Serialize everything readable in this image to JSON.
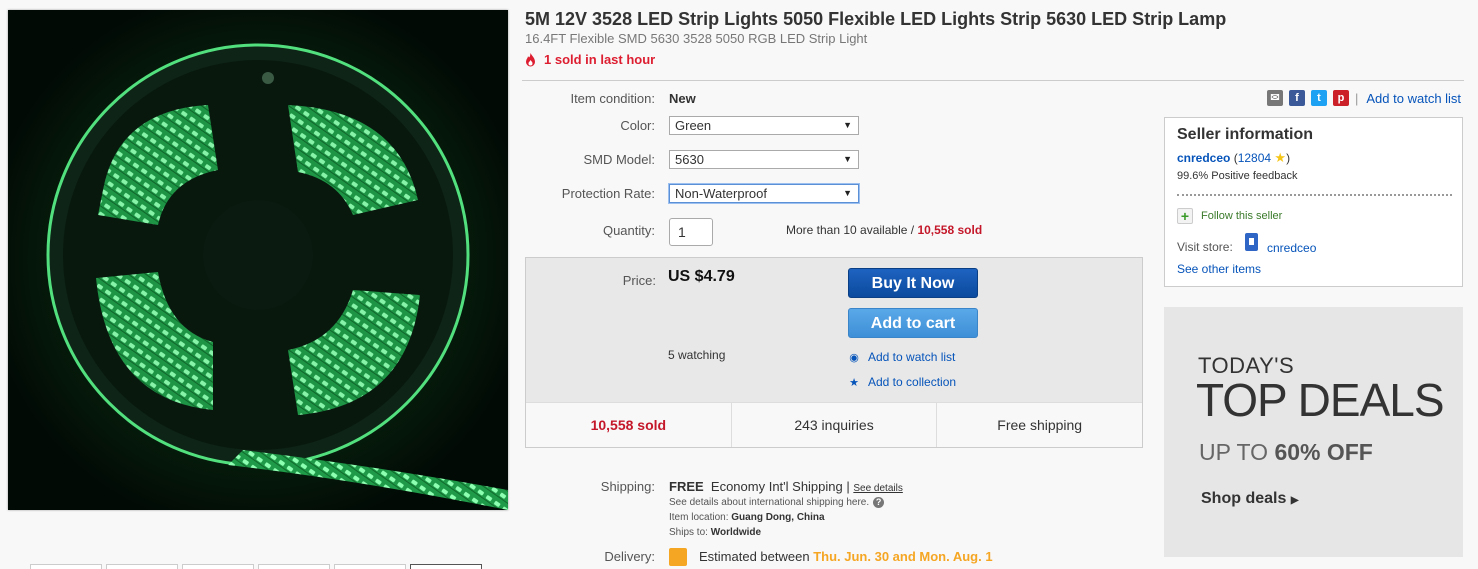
{
  "title": "5M 12V 3528 LED Strip Lights 5050 Flexible LED Lights Strip 5630 LED Strip Lamp",
  "subtitle": "16.4FT Flexible SMD 5630 3528 5050 RGB LED Strip Light",
  "hot_text": "1 sold in last hour",
  "condition": {
    "label": "Item condition:",
    "value": "New"
  },
  "options": [
    {
      "label": "Color:",
      "value": "Green"
    },
    {
      "label": "SMD Model:",
      "value": "5630"
    },
    {
      "label": "Protection Rate:",
      "value": "Non-Waterproof"
    }
  ],
  "quantity": {
    "label": "Quantity:",
    "value": "1",
    "available": "More than 10 available /",
    "sold": "10,558 sold"
  },
  "price": {
    "label": "Price:",
    "value": "US $4.79",
    "watching": "5 watching"
  },
  "buttons": {
    "buy_now": "Buy It Now",
    "add_to_cart": "Add to cart",
    "add_watch": "Add to watch list",
    "add_collection": "Add to collection"
  },
  "stats": {
    "sold": "10,558 sold",
    "inquiries": "243 inquiries",
    "shipping": "Free shipping"
  },
  "shipping": {
    "label": "Shipping:",
    "free": "FREE",
    "method": "Economy Int'l Shipping",
    "see_details": "See details",
    "intl_note": "See details about international shipping here.",
    "location_label": "Item location:",
    "location": "Guang Dong, China",
    "ships_to_label": "Ships to:",
    "ships_to": "Worldwide"
  },
  "delivery": {
    "label": "Delivery:",
    "text": "Estimated between",
    "dates": "Thu. Jun. 30 and Mon. Aug. 1"
  },
  "share": {
    "watch_link": "Add to watch list",
    "separator": "|"
  },
  "seller": {
    "heading": "Seller information",
    "name": "cnredceo",
    "score": "12804",
    "feedback": "99.6% Positive feedback",
    "follow": "Follow this seller",
    "visit_label": "Visit store:",
    "store_name": "cnredceo",
    "other_items": "See other items"
  },
  "deals": {
    "line1": "TODAY'S",
    "line2": "TOP DEALS",
    "line3_prefix": "UP TO",
    "line3_value": "60% OFF",
    "cta": "Shop deals"
  },
  "colors": {
    "accent_link": "#0654ba",
    "sold_red": "#c4182a",
    "buy_button": "#0b4a9e",
    "cart_button": "#3d8fd7",
    "delivery_orange": "#f5a623",
    "led_green": "#3ddc6b"
  }
}
